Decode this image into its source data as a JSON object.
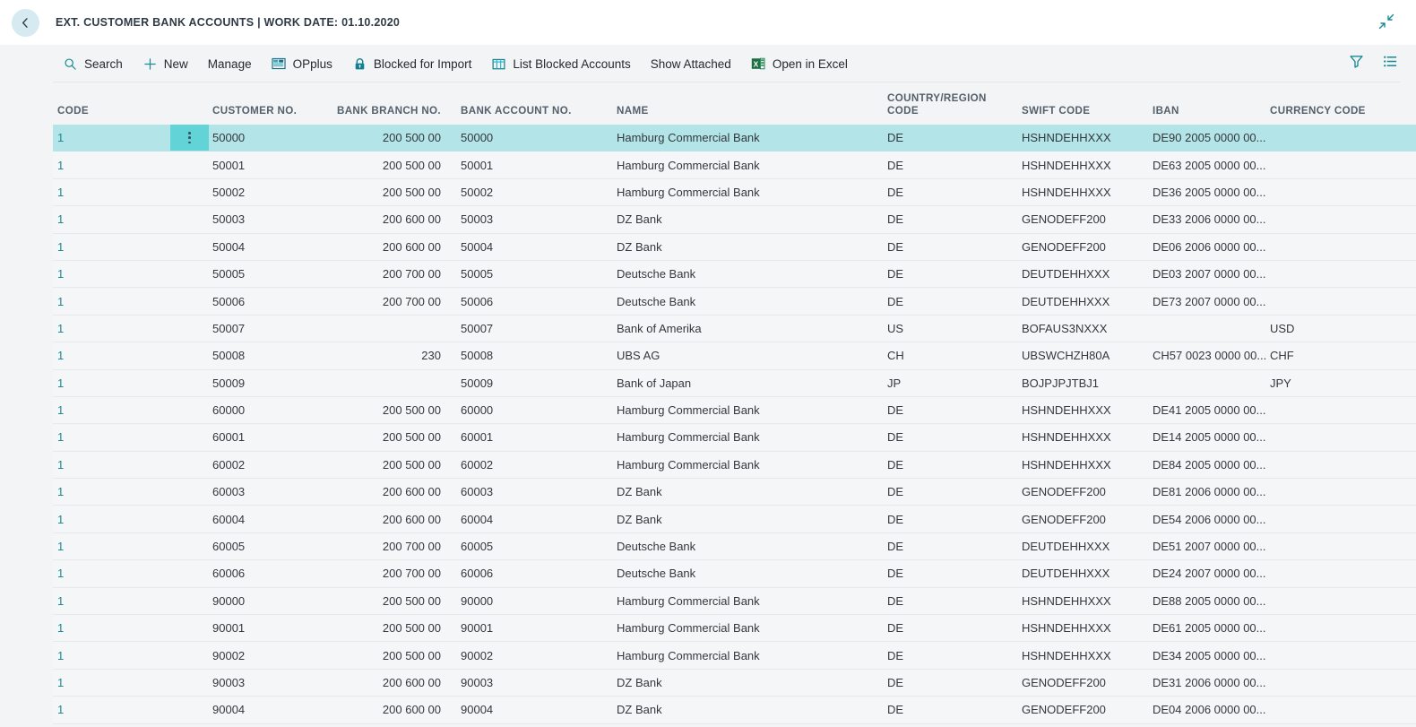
{
  "titlebar": {
    "back_icon": "back-arrow-icon",
    "title": "EXT. CUSTOMER BANK ACCOUNTS | WORK DATE: 01.10.2020",
    "collapse_icon": "collapse-diagonal-arrows-icon"
  },
  "toolbar": {
    "items": [
      {
        "label": "Search",
        "icon": "search-icon"
      },
      {
        "label": "New",
        "icon": "plus-icon"
      },
      {
        "label": "Manage",
        "icon": "none"
      },
      {
        "label": "OPplus",
        "icon": "opplus-grid-icon"
      },
      {
        "label": "Blocked for Import",
        "icon": "lock-icon"
      },
      {
        "label": "List Blocked Accounts",
        "icon": "list-table-icon"
      },
      {
        "label": "Show Attached",
        "icon": "none"
      },
      {
        "label": "Open in Excel",
        "icon": "excel-icon"
      }
    ],
    "right_items": [
      {
        "name": "filter-icon",
        "label": "Filter"
      },
      {
        "name": "list-view-icon",
        "label": "List"
      }
    ]
  },
  "colors": {
    "accent": "#1a8a94",
    "selection": "#b3e5e8",
    "row_menu": "#62d4d8",
    "excel_green": "#1d7044",
    "page_bg": "#f2f4f6"
  },
  "table": {
    "columns": [
      {
        "key": "code",
        "label": "CODE",
        "align": "left"
      },
      {
        "key": "customer_no",
        "label": "CUSTOMER NO.",
        "align": "left"
      },
      {
        "key": "bank_branch_no",
        "label": "BANK BRANCH NO.",
        "align": "right"
      },
      {
        "key": "bank_account_no",
        "label": "BANK ACCOUNT NO.",
        "align": "left"
      },
      {
        "key": "name",
        "label": "NAME",
        "align": "left"
      },
      {
        "key": "country_region_code",
        "label": "COUNTRY/REGION\nCODE",
        "align": "left"
      },
      {
        "key": "swift_code",
        "label": "SWIFT CODE",
        "align": "left"
      },
      {
        "key": "iban",
        "label": "IBAN",
        "align": "left"
      },
      {
        "key": "currency_code",
        "label": "CURRENCY CODE",
        "align": "left"
      }
    ],
    "selected_row_index": 0,
    "rows": [
      {
        "code": "1",
        "customer_no": "50000",
        "bank_branch_no": "200 500 00",
        "bank_account_no": "50000",
        "name": "Hamburg Commercial Bank",
        "country_region_code": "DE",
        "swift_code": "HSHNDEHHXXX",
        "iban": "DE90 2005 0000 00...",
        "currency_code": ""
      },
      {
        "code": "1",
        "customer_no": "50001",
        "bank_branch_no": "200 500 00",
        "bank_account_no": "50001",
        "name": "Hamburg Commercial Bank",
        "country_region_code": "DE",
        "swift_code": "HSHNDEHHXXX",
        "iban": "DE63 2005 0000 00...",
        "currency_code": ""
      },
      {
        "code": "1",
        "customer_no": "50002",
        "bank_branch_no": "200 500 00",
        "bank_account_no": "50002",
        "name": "Hamburg Commercial Bank",
        "country_region_code": "DE",
        "swift_code": "HSHNDEHHXXX",
        "iban": "DE36 2005 0000 00...",
        "currency_code": ""
      },
      {
        "code": "1",
        "customer_no": "50003",
        "bank_branch_no": "200 600 00",
        "bank_account_no": "50003",
        "name": "DZ Bank",
        "country_region_code": "DE",
        "swift_code": "GENODEFF200",
        "iban": "DE33 2006 0000 00...",
        "currency_code": ""
      },
      {
        "code": "1",
        "customer_no": "50004",
        "bank_branch_no": "200 600 00",
        "bank_account_no": "50004",
        "name": "DZ Bank",
        "country_region_code": "DE",
        "swift_code": "GENODEFF200",
        "iban": "DE06 2006 0000 00...",
        "currency_code": ""
      },
      {
        "code": "1",
        "customer_no": "50005",
        "bank_branch_no": "200 700 00",
        "bank_account_no": "50005",
        "name": "Deutsche Bank",
        "country_region_code": "DE",
        "swift_code": "DEUTDEHHXXX",
        "iban": "DE03 2007 0000 00...",
        "currency_code": ""
      },
      {
        "code": "1",
        "customer_no": "50006",
        "bank_branch_no": "200 700 00",
        "bank_account_no": "50006",
        "name": "Deutsche Bank",
        "country_region_code": "DE",
        "swift_code": "DEUTDEHHXXX",
        "iban": "DE73 2007 0000 00...",
        "currency_code": ""
      },
      {
        "code": "1",
        "customer_no": "50007",
        "bank_branch_no": "",
        "bank_account_no": "50007",
        "name": "Bank of Amerika",
        "country_region_code": "US",
        "swift_code": "BOFAUS3NXXX",
        "iban": "",
        "currency_code": "USD"
      },
      {
        "code": "1",
        "customer_no": "50008",
        "bank_branch_no": "230",
        "bank_account_no": "50008",
        "name": "UBS AG",
        "country_region_code": "CH",
        "swift_code": "UBSWCHZH80A",
        "iban": "CH57 0023 0000 00...",
        "currency_code": "CHF"
      },
      {
        "code": "1",
        "customer_no": "50009",
        "bank_branch_no": "",
        "bank_account_no": "50009",
        "name": "Bank of Japan",
        "country_region_code": "JP",
        "swift_code": "BOJPJPJTBJ1",
        "iban": "",
        "currency_code": "JPY"
      },
      {
        "code": "1",
        "customer_no": "60000",
        "bank_branch_no": "200 500 00",
        "bank_account_no": "60000",
        "name": "Hamburg Commercial Bank",
        "country_region_code": "DE",
        "swift_code": "HSHNDEHHXXX",
        "iban": "DE41 2005 0000 00...",
        "currency_code": ""
      },
      {
        "code": "1",
        "customer_no": "60001",
        "bank_branch_no": "200 500 00",
        "bank_account_no": "60001",
        "name": "Hamburg Commercial Bank",
        "country_region_code": "DE",
        "swift_code": "HSHNDEHHXXX",
        "iban": "DE14 2005 0000 00...",
        "currency_code": ""
      },
      {
        "code": "1",
        "customer_no": "60002",
        "bank_branch_no": "200 500 00",
        "bank_account_no": "60002",
        "name": "Hamburg Commercial Bank",
        "country_region_code": "DE",
        "swift_code": "HSHNDEHHXXX",
        "iban": "DE84 2005 0000 00...",
        "currency_code": ""
      },
      {
        "code": "1",
        "customer_no": "60003",
        "bank_branch_no": "200 600 00",
        "bank_account_no": "60003",
        "name": "DZ Bank",
        "country_region_code": "DE",
        "swift_code": "GENODEFF200",
        "iban": "DE81 2006 0000 00...",
        "currency_code": ""
      },
      {
        "code": "1",
        "customer_no": "60004",
        "bank_branch_no": "200 600 00",
        "bank_account_no": "60004",
        "name": "DZ Bank",
        "country_region_code": "DE",
        "swift_code": "GENODEFF200",
        "iban": "DE54 2006 0000 00...",
        "currency_code": ""
      },
      {
        "code": "1",
        "customer_no": "60005",
        "bank_branch_no": "200 700 00",
        "bank_account_no": "60005",
        "name": "Deutsche Bank",
        "country_region_code": "DE",
        "swift_code": "DEUTDEHHXXX",
        "iban": "DE51 2007 0000 00...",
        "currency_code": ""
      },
      {
        "code": "1",
        "customer_no": "60006",
        "bank_branch_no": "200 700 00",
        "bank_account_no": "60006",
        "name": "Deutsche Bank",
        "country_region_code": "DE",
        "swift_code": "DEUTDEHHXXX",
        "iban": "DE24 2007 0000 00...",
        "currency_code": ""
      },
      {
        "code": "1",
        "customer_no": "90000",
        "bank_branch_no": "200 500 00",
        "bank_account_no": "90000",
        "name": "Hamburg Commercial Bank",
        "country_region_code": "DE",
        "swift_code": "HSHNDEHHXXX",
        "iban": "DE88 2005 0000 00...",
        "currency_code": ""
      },
      {
        "code": "1",
        "customer_no": "90001",
        "bank_branch_no": "200 500 00",
        "bank_account_no": "90001",
        "name": "Hamburg Commercial Bank",
        "country_region_code": "DE",
        "swift_code": "HSHNDEHHXXX",
        "iban": "DE61 2005 0000 00...",
        "currency_code": ""
      },
      {
        "code": "1",
        "customer_no": "90002",
        "bank_branch_no": "200 500 00",
        "bank_account_no": "90002",
        "name": "Hamburg Commercial Bank",
        "country_region_code": "DE",
        "swift_code": "HSHNDEHHXXX",
        "iban": "DE34 2005 0000 00...",
        "currency_code": ""
      },
      {
        "code": "1",
        "customer_no": "90003",
        "bank_branch_no": "200 600 00",
        "bank_account_no": "90003",
        "name": "DZ Bank",
        "country_region_code": "DE",
        "swift_code": "GENODEFF200",
        "iban": "DE31 2006 0000 00...",
        "currency_code": ""
      },
      {
        "code": "1",
        "customer_no": "90004",
        "bank_branch_no": "200 600 00",
        "bank_account_no": "90004",
        "name": "DZ Bank",
        "country_region_code": "DE",
        "swift_code": "GENODEFF200",
        "iban": "DE04 2006 0000 00...",
        "currency_code": ""
      }
    ]
  }
}
